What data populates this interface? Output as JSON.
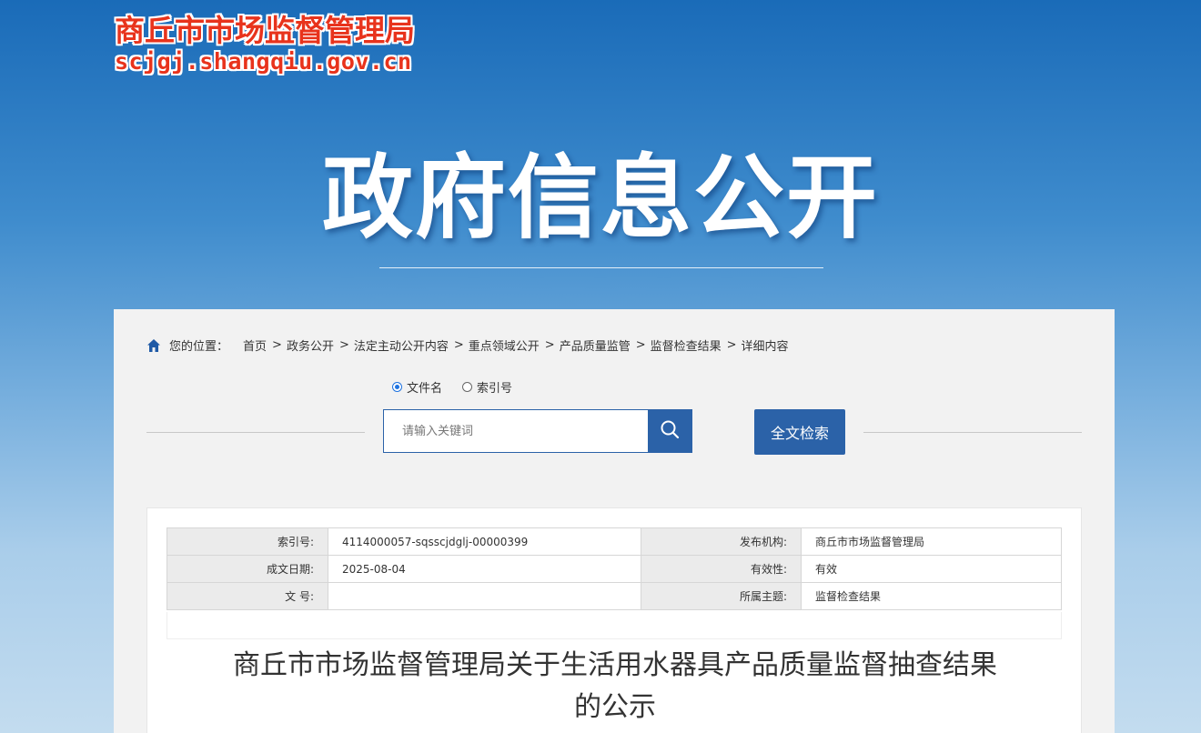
{
  "header": {
    "logo_title": "商丘市市场监督管理局",
    "logo_url": "scjgj.shangqiu.gov.cn",
    "hero_title": "政府信息公开"
  },
  "breadcrumb": {
    "icon": "home-icon",
    "label": "您的位置：",
    "items": [
      "首页",
      "政务公开",
      "法定主动公开内容",
      "重点领域公开",
      "产品质量监管",
      "监督检查结果",
      "详细内容"
    ],
    "separator": ">"
  },
  "search": {
    "options": [
      {
        "label": "文件名",
        "checked": true
      },
      {
        "label": "索引号",
        "checked": false
      }
    ],
    "placeholder": "请输入关键词",
    "value": "",
    "search_icon": "search-icon",
    "fulltext_label": "全文检索"
  },
  "meta": {
    "rows": [
      {
        "k1": "索引号:",
        "v1": "4114000057-sqsscjdglj-00000399",
        "k2": "发布机构:",
        "v2": "商丘市市场监督管理局"
      },
      {
        "k1": "成文日期:",
        "v1": "2025-08-04",
        "k2": "有效性:",
        "v2": "有效"
      },
      {
        "k1": "文 号:",
        "v1": "",
        "k2": "所属主题:",
        "v2": "监督检查结果"
      }
    ]
  },
  "document": {
    "title_line1": "商丘市市场监督管理局关于生活用水器具产品质量监督抽查结果",
    "title_line2": "的公示"
  },
  "colors": {
    "accent": "#2b62a8",
    "logo_red": "#e8331c",
    "panel_bg": "#f2f2f2"
  }
}
